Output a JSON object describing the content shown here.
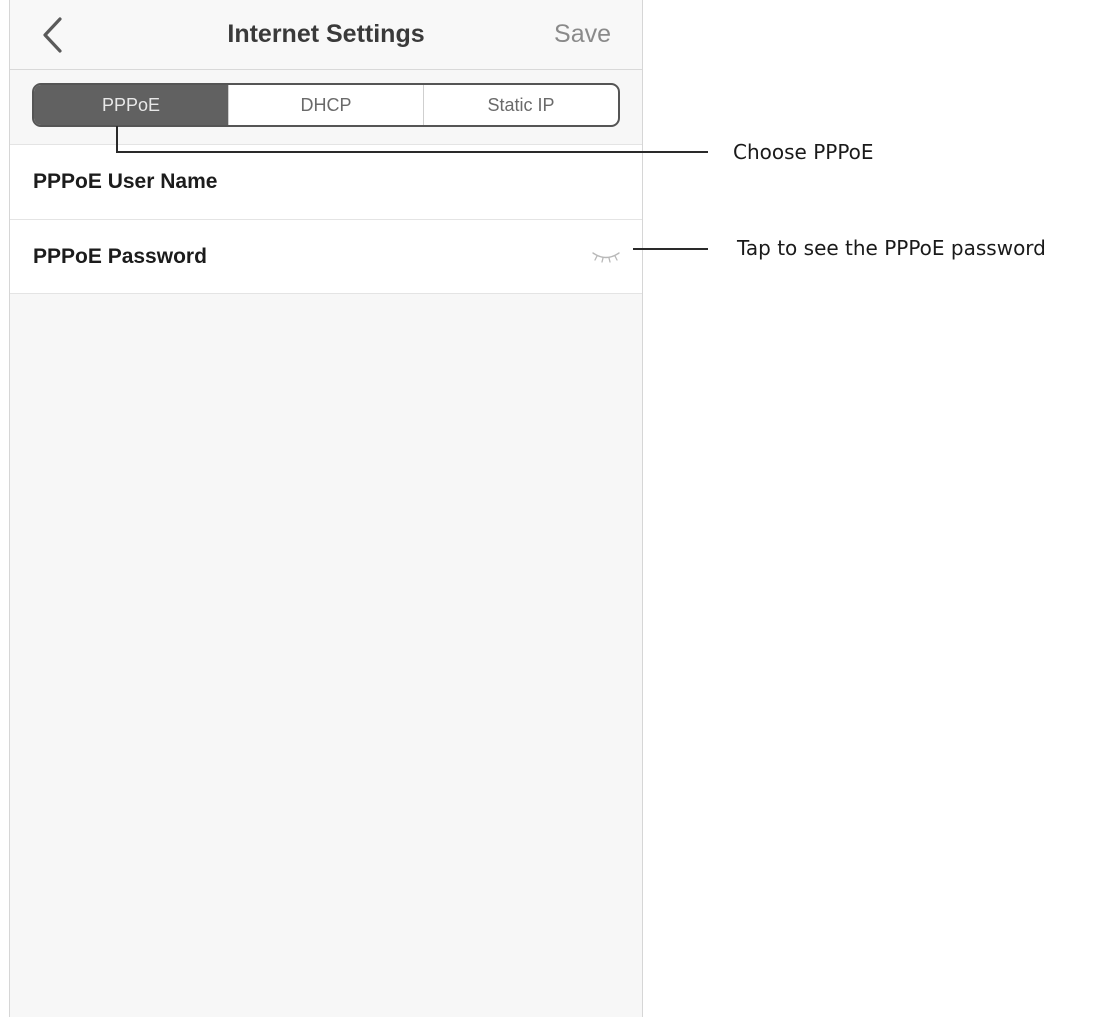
{
  "header": {
    "title": "Internet Settings",
    "save_label": "Save",
    "back_icon": "chevron-left-icon"
  },
  "connection_tabs": [
    {
      "label": "PPPoE",
      "selected": true
    },
    {
      "label": "DHCP",
      "selected": false
    },
    {
      "label": "Static IP",
      "selected": false
    }
  ],
  "fields": {
    "user_name_label": "PPPoE User Name",
    "password_label": "PPPoE Password",
    "password_toggle_icon": "eye-closed-icon"
  },
  "annotations": {
    "choose_pppoe": "Choose PPPoE",
    "tap_to_see_password": "Tap to see the PPPoE password"
  },
  "colors": {
    "selected_tab": "#616161",
    "background": "#f7f7f7",
    "title_text": "#3a3a3a"
  }
}
